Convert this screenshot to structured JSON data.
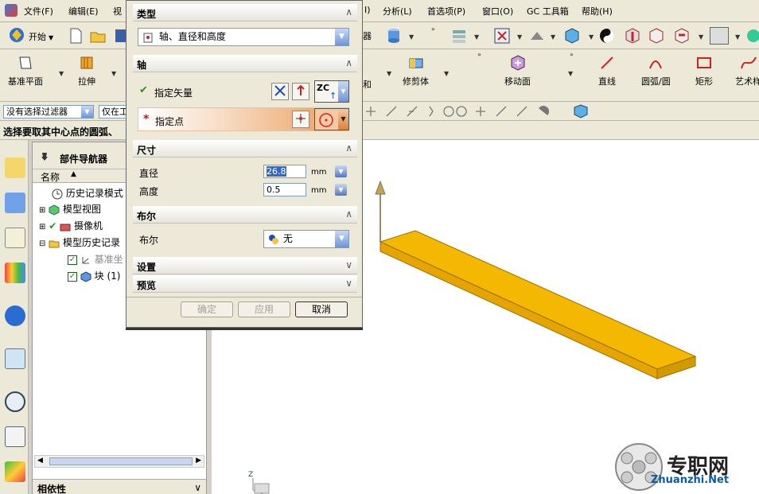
{
  "menubar": {
    "items": [
      {
        "label": "文件(F)"
      },
      {
        "label": "编辑(E)"
      },
      {
        "label": "视"
      },
      {
        "label": "I)"
      },
      {
        "label": "分析(L)"
      },
      {
        "label": "首选项(P)"
      },
      {
        "label": "窗口(O)"
      },
      {
        "label": "GC 工具箱"
      },
      {
        "label": "帮助(H)"
      }
    ]
  },
  "toolbar1": {
    "start_label": "开始",
    "partial_label": "器"
  },
  "toolbar2": {
    "datum_plane_label": "基准平面",
    "extrude_label": "拉伸",
    "partial_label": "和",
    "trim_body_label": "修剪体",
    "move_face_label": "移动面",
    "line_label": "直线",
    "arc_label": "圆弧/圆",
    "rectangle_label": "矩形",
    "art_label": "艺术样"
  },
  "toolbar3": {
    "filter_label": "没有选择过滤器",
    "scope_label": "仅在工"
  },
  "prompt": {
    "text": "选择要取其中心点的圆弧、"
  },
  "navigator": {
    "title": "部件导航器",
    "column_name": "名称",
    "rows": [
      {
        "label": "历史记录模式"
      },
      {
        "label": "模型视图"
      },
      {
        "label": "摄像机"
      },
      {
        "label": "模型历史记录"
      },
      {
        "label": "基准坐"
      },
      {
        "label": "块 (1)"
      }
    ],
    "dependencies_label": "相依性"
  },
  "dialog": {
    "type_section": "类型",
    "type_value": "轴、直径和高度",
    "axis_section": "轴",
    "specify_vector": "指定矢量",
    "vector_option": "ZC",
    "specify_point": "指定点",
    "dims_section": "尺寸",
    "diameter_label": "直径",
    "diameter_value": "26.8",
    "height_label": "高度",
    "height_value": "0.5",
    "unit": "mm",
    "boolean_section": "布尔",
    "boolean_label": "布尔",
    "boolean_value": "无",
    "settings_section": "设置",
    "preview_section": "预览",
    "ok_label": "确定",
    "apply_label": "应用",
    "cancel_label": "取消"
  },
  "graphics": {
    "axis_label": "Z"
  },
  "watermark": {
    "brand_cn": "专职网",
    "brand_url": "Zhuanzhi.Net"
  },
  "colors": {
    "part_face": "#f5b800",
    "part_side": "#d39a00",
    "required_star": "#d01010",
    "check_green": "#1b9a1b",
    "point_highlight": "#e89b5a"
  }
}
